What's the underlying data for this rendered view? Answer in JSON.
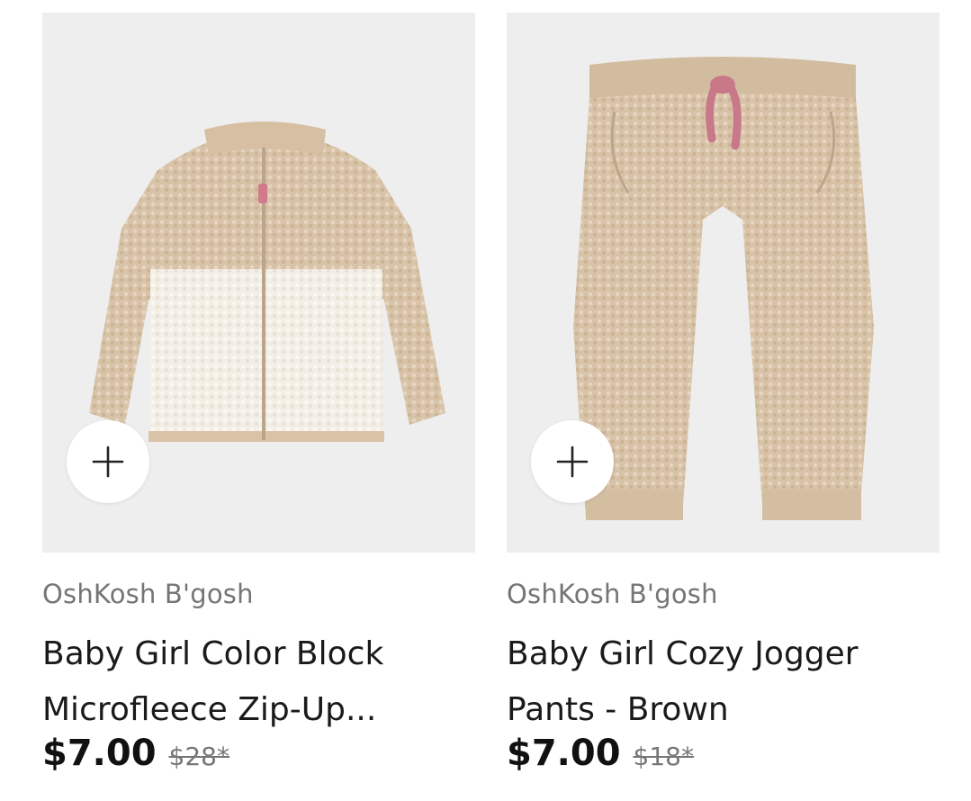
{
  "products": [
    {
      "brand": "OshKosh B'gosh",
      "title_line1": "Baby Girl Color Block",
      "title_line2": "Microfleece Zip-Up...",
      "price": "$7.00",
      "original_price": "$28*",
      "image_icon": "fleece-jacket-image",
      "add_icon": "plus-icon"
    },
    {
      "brand": "OshKosh B'gosh",
      "title_line1": "Baby Girl Cozy Jogger",
      "title_line2": "Pants - Brown",
      "price": "$7.00",
      "original_price": "$18*",
      "image_icon": "jogger-pants-image",
      "add_icon": "plus-icon"
    }
  ],
  "colors": {
    "image_bg": "#eeeeee",
    "fleece_tan": "#d8c2a6",
    "fleece_cream": "#f3efe6",
    "drawstring_pink": "#c9788a",
    "brand_text": "#757575",
    "title_text": "#1a1a1a"
  }
}
